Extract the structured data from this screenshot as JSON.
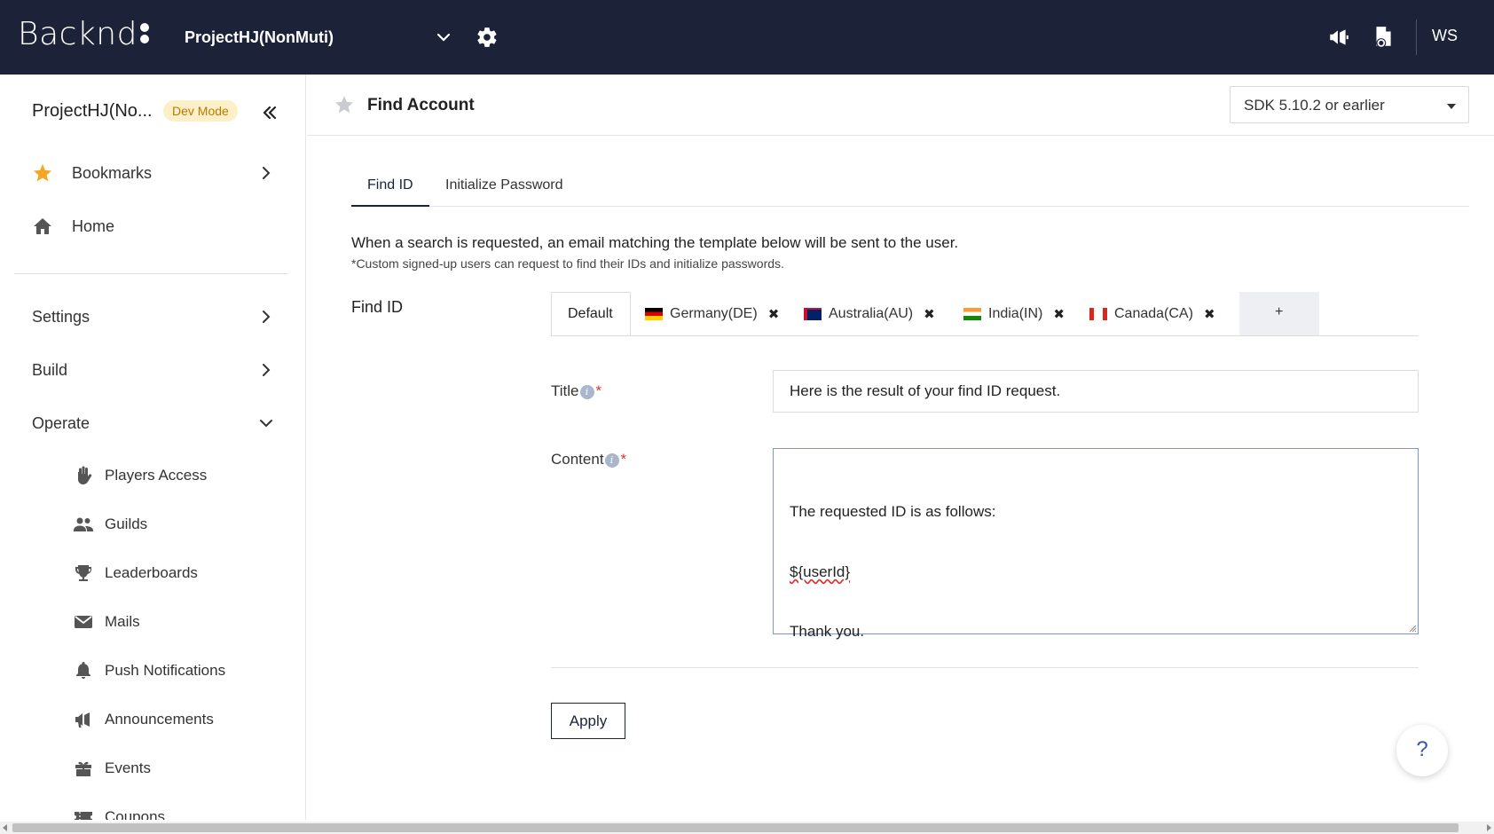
{
  "topbar": {
    "logo": "Backnd",
    "project": "ProjectHJ(NonMuti)",
    "user": "WS",
    "icons": [
      "chevron-down-icon",
      "gear-icon",
      "megaphone-icon",
      "document-gear-icon"
    ]
  },
  "sidebar": {
    "project": "ProjectHJ(No...",
    "badge": "Dev Mode",
    "items": {
      "bookmarks": "Bookmarks",
      "home": "Home",
      "settings": "Settings",
      "build": "Build",
      "operate": "Operate"
    },
    "operate_items": [
      "Players Access",
      "Guilds",
      "Leaderboards",
      "Mails",
      "Push Notifications",
      "Announcements",
      "Events",
      "Coupons"
    ]
  },
  "header": {
    "title": "Find Account",
    "sdk": "SDK 5.10.2 or earlier"
  },
  "tabs": [
    "Find ID",
    "Initialize Password"
  ],
  "description": {
    "line1": "When a search is requested, an email matching the template below will be sent to the user.",
    "line2": "*Custom signed-up users can request to find their IDs and initialize passwords."
  },
  "form": {
    "section_label": "Find ID",
    "default_tab": "Default",
    "languages": [
      "Germany(DE)",
      "Australia(AU)",
      "India(IN)",
      "Canada(CA)"
    ],
    "add_label": "+",
    "title_label": "Title",
    "content_label": "Content",
    "required_mark": "*",
    "title_value": "Here is the result of your find ID request.",
    "content_lines": [
      "The requested ID is as follows:",
      "${userId}",
      "Thank you."
    ],
    "apply_label": "Apply"
  },
  "help": "?",
  "colors": {
    "topbar": "#1c2338",
    "accent": "#f5a623",
    "badge_bg": "#fdf0c8",
    "badge_text": "#b27a00",
    "required": "#e03030"
  }
}
